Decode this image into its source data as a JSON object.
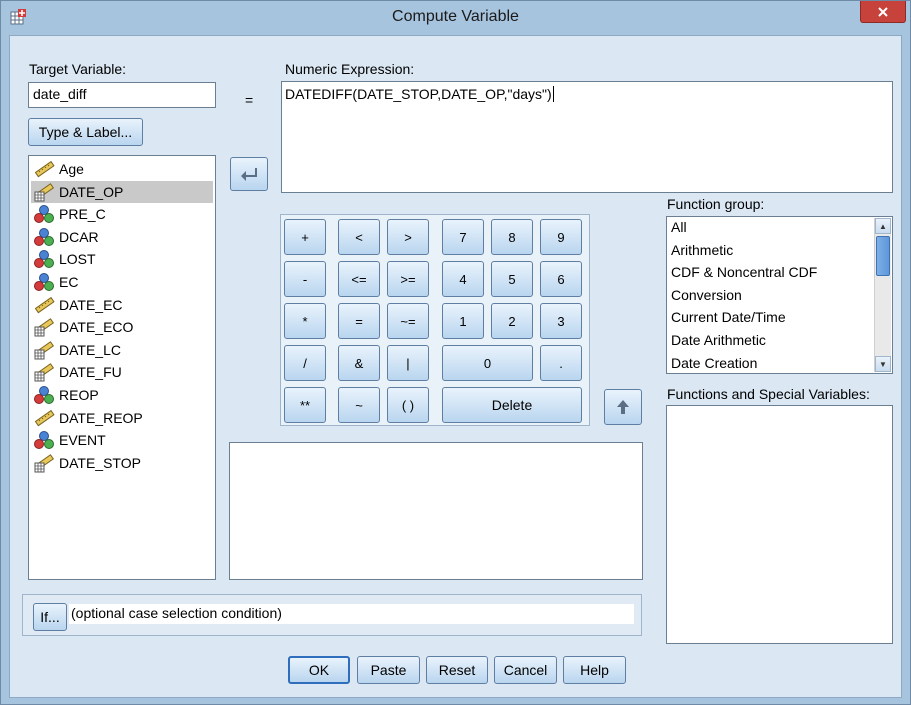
{
  "window": {
    "title": "Compute Variable"
  },
  "target": {
    "label": "Target Variable:",
    "value": "date_diff",
    "equals": "="
  },
  "type_label_button": "Type & Label...",
  "expression": {
    "label": "Numeric Expression:",
    "value": "DATEDIFF(DATE_STOP,DATE_OP,\"days\")"
  },
  "variables": [
    {
      "name": "Age",
      "icon": "scale-ruler-icon"
    },
    {
      "name": "DATE_OP",
      "icon": "date-scale-icon",
      "selected": true
    },
    {
      "name": "PRE_C",
      "icon": "nominal-icon"
    },
    {
      "name": "DCAR",
      "icon": "nominal-icon"
    },
    {
      "name": "LOST",
      "icon": "nominal-icon"
    },
    {
      "name": "EC",
      "icon": "nominal-icon"
    },
    {
      "name": "DATE_EC",
      "icon": "scale-ruler-icon"
    },
    {
      "name": "DATE_ECO",
      "icon": "date-scale-icon"
    },
    {
      "name": "DATE_LC",
      "icon": "date-scale-icon"
    },
    {
      "name": "DATE_FU",
      "icon": "date-scale-icon"
    },
    {
      "name": "REOP",
      "icon": "nominal-icon"
    },
    {
      "name": "DATE_REOP",
      "icon": "scale-ruler-icon"
    },
    {
      "name": "EVENT",
      "icon": "nominal-icon"
    },
    {
      "name": "DATE_STOP",
      "icon": "date-scale-icon"
    }
  ],
  "keypad": {
    "plus": "+",
    "lt": "<",
    "gt": ">",
    "k7": "7",
    "k8": "8",
    "k9": "9",
    "minus": "-",
    "le": "<=",
    "ge": ">=",
    "k4": "4",
    "k5": "5",
    "k6": "6",
    "times": "*",
    "eq": "=",
    "ne": "~=",
    "k1": "1",
    "k2": "2",
    "k3": "3",
    "div": "/",
    "and": "&",
    "or": "|",
    "k0": "0",
    "dot": ".",
    "pow": "**",
    "not": "~",
    "parens": "( )",
    "delete": "Delete"
  },
  "function_group": {
    "label": "Function group:",
    "items": [
      "All",
      "Arithmetic",
      "CDF & Noncentral CDF",
      "Conversion",
      "Current Date/Time",
      "Date Arithmetic",
      "Date Creation"
    ]
  },
  "functions_label": "Functions and Special Variables:",
  "if_condition": {
    "button": "If...",
    "text": "(optional case selection condition)"
  },
  "buttons": {
    "ok": "OK",
    "paste": "Paste",
    "reset": "Reset",
    "cancel": "Cancel",
    "help": "Help"
  },
  "colors": {
    "titlebar": "#a7c4df",
    "client": "#dbe8f4",
    "selection": "#c9c9c9",
    "close": "#c7423a"
  }
}
